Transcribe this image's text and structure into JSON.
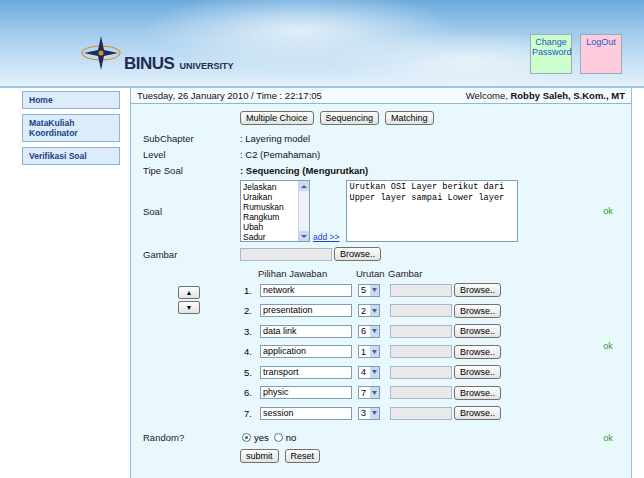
{
  "header": {
    "logo": "BINUS",
    "logo_sub": "UNIVERSITY",
    "links": [
      {
        "label": "Change Password",
        "color": "#ccffcc"
      },
      {
        "label": "LogOut",
        "color": "#ffccdd"
      }
    ]
  },
  "sidebar": {
    "items": [
      {
        "label": "Home"
      },
      {
        "label": "MataKuliah Koordinator"
      },
      {
        "label": "Verifikasi Soal"
      }
    ]
  },
  "topbar": {
    "date": "Tuesday, 26 January 2010 / Time : 22:17:05",
    "welcome": "Welcome, ",
    "user": "Robby Saleh, S.Kom., MT"
  },
  "type_buttons": [
    "Multiple Choice",
    "Sequencing",
    "Matching"
  ],
  "fields": [
    {
      "label": "SubChapter",
      "value": ": Layering model",
      "bold": false
    },
    {
      "label": "Level",
      "value": ": C2 (Pemahaman)",
      "bold": false
    },
    {
      "label": "Tipe Soal",
      "value": ": Sequencing (Mengurutkan)",
      "bold": true
    }
  ],
  "soal": {
    "label": "Soal",
    "verbs": [
      "Jelaskan",
      "Uraikan",
      "Rumuskan",
      "Rangkum",
      "Ubah",
      "Sadur"
    ],
    "add_link": "add >>",
    "text": "Urutkan OSI Layer berikut dari Upper layer sampai Lower layer",
    "status": "ok"
  },
  "gambar": {
    "label": "Gambar",
    "button": "Browse.."
  },
  "answers": {
    "columns": [
      "Pilihan Jawaban",
      "Urutan",
      "Gambar"
    ],
    "move_buttons": [
      "▲",
      "▼"
    ],
    "status": "ok",
    "rows": [
      {
        "number": "1.",
        "text": "network",
        "order": "5",
        "button": "Browse.."
      },
      {
        "number": "2.",
        "text": "presentation",
        "order": "2",
        "button": "Browse.."
      },
      {
        "number": "3.",
        "text": "data link",
        "order": "6",
        "button": "Browse.."
      },
      {
        "number": "4.",
        "text": "application",
        "order": "1",
        "button": "Browse.."
      },
      {
        "number": "5.",
        "text": "transport",
        "order": "4",
        "button": "Browse.."
      },
      {
        "number": "6.",
        "text": "physic",
        "order": "7",
        "button": "Browse.."
      },
      {
        "number": "7.",
        "text": "session",
        "order": "3",
        "button": "Browse.."
      }
    ]
  },
  "random": {
    "label": "Random?",
    "options": [
      {
        "label": "yes",
        "selected": true
      },
      {
        "label": "no",
        "selected": false
      }
    ],
    "status": "ok"
  },
  "actions": [
    "submit",
    "Reset"
  ]
}
